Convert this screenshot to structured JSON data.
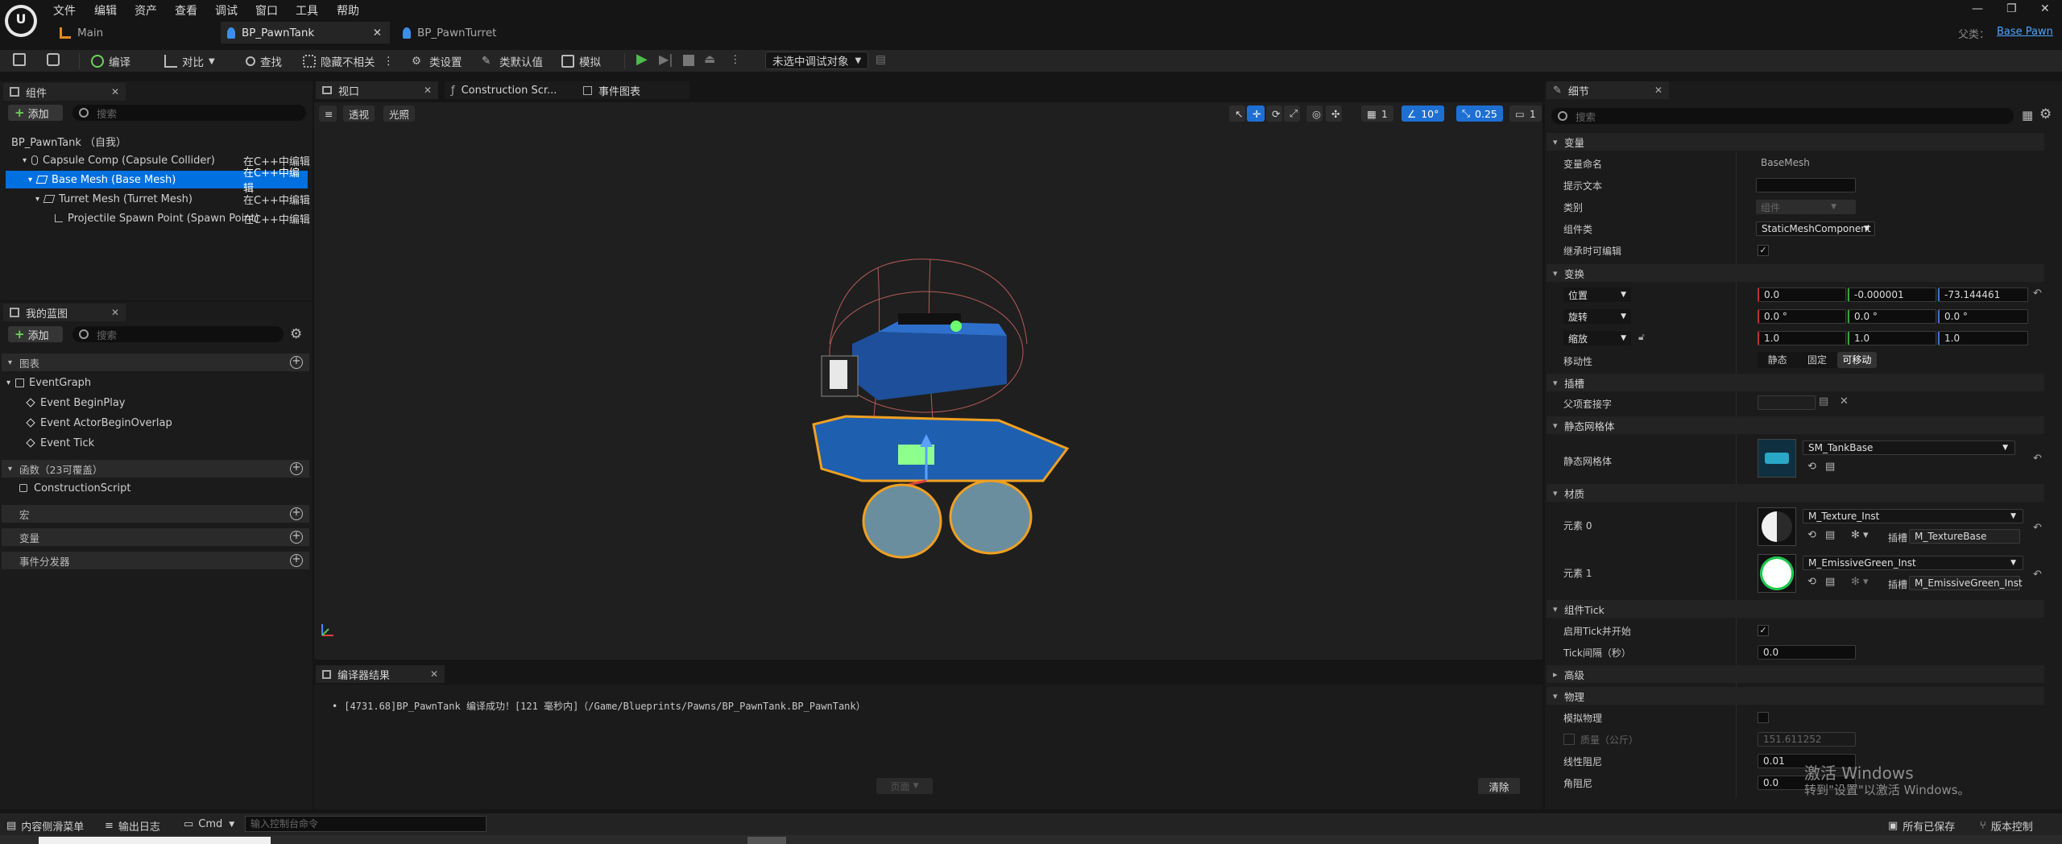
{
  "menu": [
    "文件",
    "编辑",
    "资产",
    "查看",
    "调试",
    "窗口",
    "工具",
    "帮助"
  ],
  "tabs": [
    {
      "label": "Main"
    },
    {
      "label": "BP_PawnTank"
    },
    {
      "label": "BP_PawnTurret"
    }
  ],
  "parent_class": {
    "label": "父类：",
    "value": "Base Pawn"
  },
  "toolbar": {
    "compile": "编译",
    "diff": "对比",
    "find": "查找",
    "hide_unrelated": "隐藏不相关",
    "class_settings": "类设置",
    "class_defaults": "类默认值",
    "simulate": "模拟",
    "debug_target": "未选中调试对象"
  },
  "components_panel": {
    "tab": "组件",
    "add": "添加",
    "search_placeholder": "搜索",
    "items": [
      {
        "name": "BP_PawnTank （自我）",
        "edit": ""
      },
      {
        "name": "Capsule Comp (Capsule Collider)",
        "edit": "在C++中编辑"
      },
      {
        "name": "Base Mesh (Base Mesh)",
        "edit": "在C++中编辑"
      },
      {
        "name": "Turret Mesh (Turret Mesh)",
        "edit": "在C++中编辑"
      },
      {
        "name": "Projectile Spawn Point (Spawn Point)",
        "edit": "在C++中编辑"
      }
    ]
  },
  "blueprint_panel": {
    "tab": "我的蓝图",
    "add": "添加",
    "search_placeholder": "搜索",
    "graphs_section": "图表",
    "event_graph": "EventGraph",
    "events": [
      "Event BeginPlay",
      "Event ActorBeginOverlap",
      "Event Tick"
    ],
    "functions_section": "函数（23可覆盖）",
    "construction_script": "ConstructionScript",
    "macros_section": "宏",
    "variables_section": "变量",
    "dispatchers_section": "事件分发器"
  },
  "center_tabs": {
    "viewport": "视口",
    "construction": "Construction Scr...",
    "event_graph": "事件图表"
  },
  "viewport": {
    "perspective": "透视",
    "lit": "光照",
    "grid_snap": "1",
    "rotation_snap": "10°",
    "scale_snap": "0.25",
    "camera_speed": "1"
  },
  "compiler": {
    "tab": "编译器结果",
    "message": "[4731.68]BP_PawnTank 编译成功！[121 毫秒内]（/Game/Blueprints/Pawns/BP_PawnTank.BP_PawnTank）",
    "page": "页面",
    "clear": "清除"
  },
  "details": {
    "tab": "细节",
    "search_placeholder": "搜索",
    "variable_section": "变量",
    "variable_name_label": "变量命名",
    "variable_name_value": "BaseMesh",
    "tooltip_label": "提示文本",
    "category_label": "类别",
    "category_value": "组件",
    "component_class_label": "组件类",
    "component_class_value": "StaticMeshComponent",
    "editable_label": "继承时可编辑",
    "transform_section": "变换",
    "location": "位置",
    "location_values": [
      "0.0",
      "-0.000001",
      "-73.144461"
    ],
    "rotation": "旋转",
    "rotation_values": [
      "0.0 °",
      "0.0 °",
      "0.0 °"
    ],
    "scale": "缩放",
    "scale_values": [
      "1.0",
      "1.0",
      "1.0"
    ],
    "mobility_label": "移动性",
    "mobility_options": [
      "静态",
      "固定",
      "可移动"
    ],
    "sockets_section": "插槽",
    "parent_socket_label": "父项套接字",
    "static_mesh_section": "静态网格体",
    "static_mesh_label": "静态网格体",
    "static_mesh_value": "SM_TankBase",
    "materials_section": "材质",
    "element0_label": "元素 0",
    "element0_value": "M_Texture_Inst",
    "element0_slot_label": "插槽",
    "element0_slot": "M_TextureBase",
    "element1_label": "元素 1",
    "element1_value": "M_EmissiveGreen_Inst",
    "element1_slot_label": "插槽",
    "element1_slot": "M_EmissiveGreen_Inst",
    "tick_section": "组件Tick",
    "tick_start_label": "启用Tick并开始",
    "tick_interval_label": "Tick间隔（秒）",
    "tick_interval_value": "0.0",
    "advanced_section": "高级",
    "physics_section": "物理",
    "simulate_physics_label": "模拟物理",
    "mass_label": "质量（公斤）",
    "mass_value": "151.611252",
    "linear_damping_label": "线性阻尼",
    "linear_damping_value": "0.01",
    "angular_damping_label": "角阻尼",
    "angular_damping_value": "0.0"
  },
  "bottom": {
    "content_drawer": "内容侧滑菜单",
    "output_log": "输出日志",
    "cmd": "Cmd",
    "console_placeholder": "输入控制台命令",
    "all_saved": "所有已保存",
    "source_control": "版本控制"
  },
  "watermark": {
    "line1": "激活 Windows",
    "line2": "转到\"设置\"以激活 Windows。"
  },
  "colors": {
    "accent_blue": "#0a5fd0",
    "selection": "#0070e0",
    "play_green": "#4dbb4d",
    "orange": "#e58a1f"
  }
}
